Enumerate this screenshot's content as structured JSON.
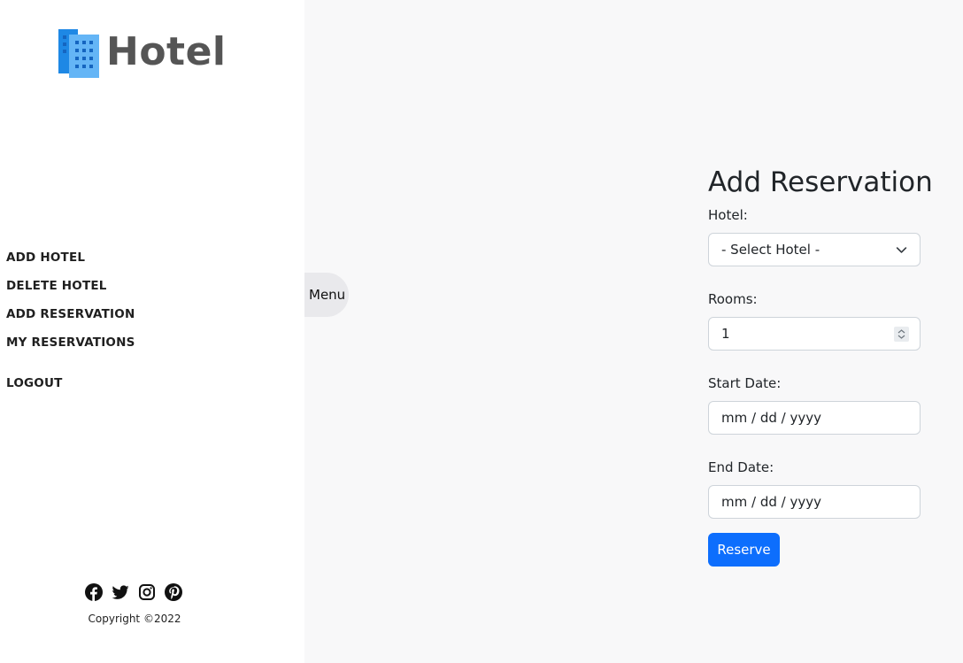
{
  "brand": {
    "name": "Hotel",
    "icon": "office-building-icon",
    "icon_color": "#1e88e5"
  },
  "nav": {
    "add_hotel": "ADD HOTEL",
    "delete_hotel": "DELETE HOTEL",
    "add_reservation": "ADD RESERVATION",
    "my_reservations": "MY RESERVATIONS",
    "logout": "LOGOUT"
  },
  "menu_toggle": "Menu",
  "social": [
    "facebook-icon",
    "twitter-icon",
    "instagram-icon",
    "pinterest-icon"
  ],
  "footer": {
    "copyright": "Copyright ©2022"
  },
  "form": {
    "title": "Add Reservation",
    "hotel_label": "Hotel:",
    "hotel_selected": "- Select Hotel -",
    "rooms_label": "Rooms:",
    "rooms_value": "1",
    "start_label": "Start Date:",
    "start_placeholder": "mm / dd / yyyy",
    "end_label": "End Date:",
    "end_placeholder": "mm / dd / yyyy",
    "submit": "Reserve"
  },
  "colors": {
    "accent": "#0d6efd",
    "sidebar_bg": "#ffffff",
    "page_bg": "#f8f8f9"
  }
}
